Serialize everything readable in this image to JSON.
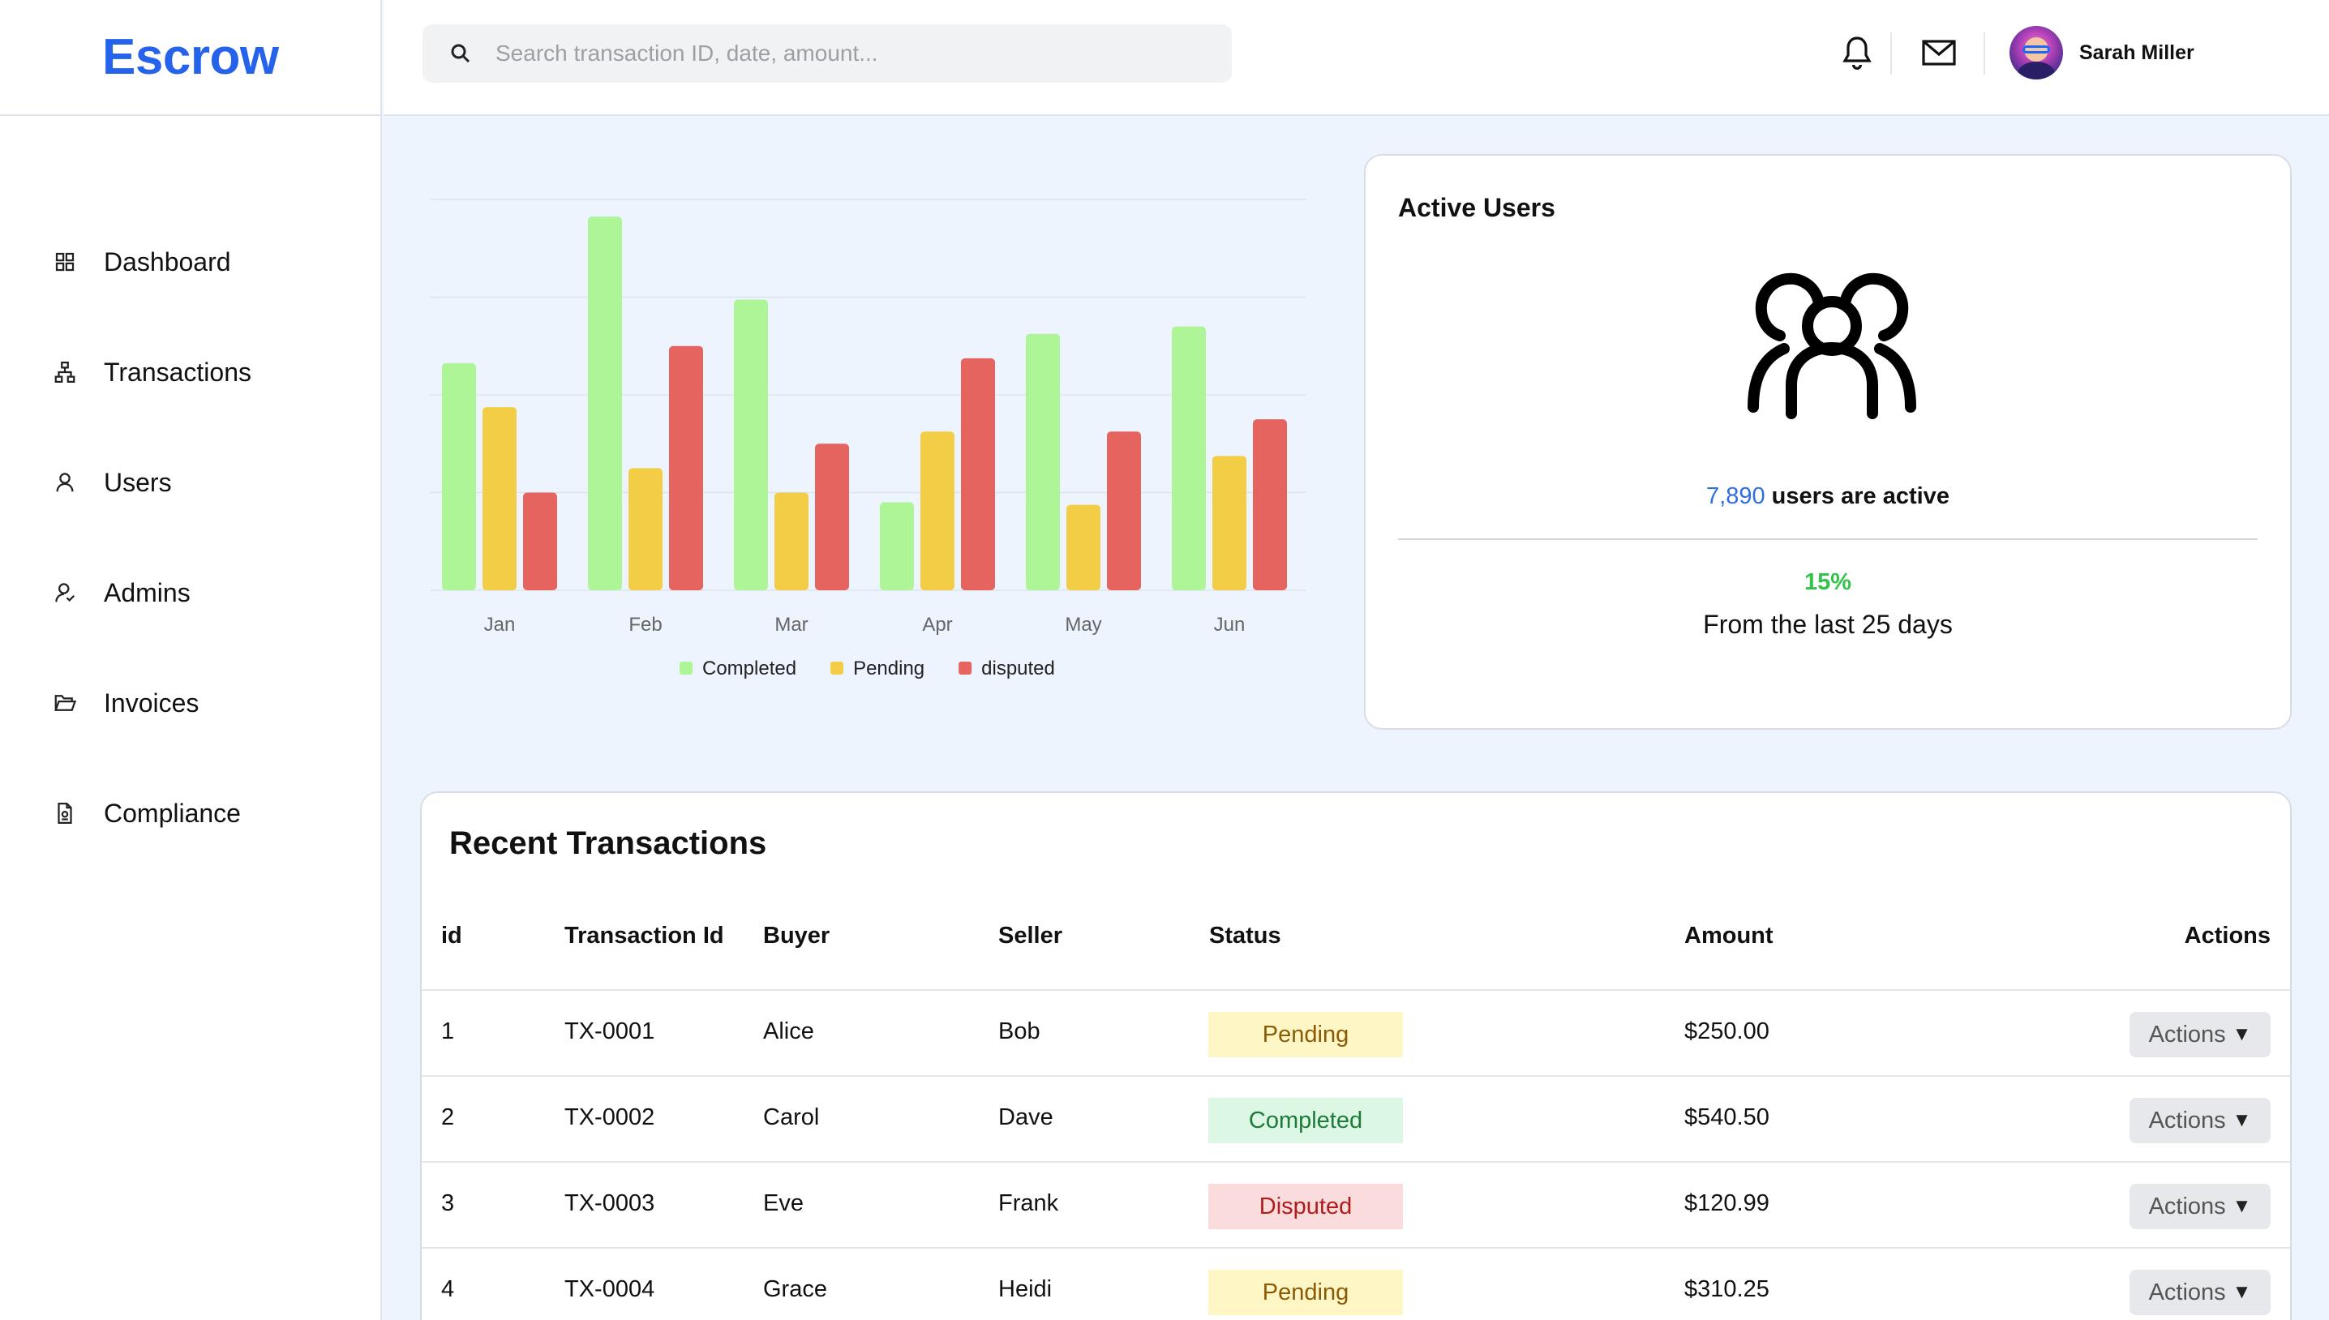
{
  "app": {
    "logo": "Escrow"
  },
  "sidebar": {
    "items": [
      {
        "label": "Dashboard",
        "icon": "grid-icon"
      },
      {
        "label": "Transactions",
        "icon": "sitemap-icon"
      },
      {
        "label": "Users",
        "icon": "user-icon"
      },
      {
        "label": "Admins",
        "icon": "admin-user-icon"
      },
      {
        "label": "Invoices",
        "icon": "folder-open-icon"
      },
      {
        "label": "Compliance",
        "icon": "document-icon"
      }
    ]
  },
  "header": {
    "search_placeholder": "Search transaction ID, date, amount...",
    "user_name": "Sarah Miller"
  },
  "colors": {
    "brand": "#2563eb",
    "completed": "#adf597",
    "pending": "#f3cd45",
    "disputed": "#e5645f"
  },
  "chart_data": {
    "type": "bar",
    "categories": [
      "Jan",
      "Feb",
      "Mar",
      "Apr",
      "May",
      "Jun"
    ],
    "series": [
      {
        "name": "Completed",
        "values": [
          93,
          153,
          119,
          36,
          105,
          108
        ]
      },
      {
        "name": "Pending",
        "values": [
          75,
          50,
          40,
          65,
          35,
          55
        ]
      },
      {
        "name": "disputed",
        "values": [
          40,
          100,
          60,
          95,
          65,
          70
        ]
      }
    ],
    "ylim": [
      0,
      160
    ],
    "grid": true,
    "legend": "bottom"
  },
  "active_users": {
    "title": "Active Users",
    "count": "7,890",
    "count_suffix": "users are active",
    "change": "15%",
    "period": "From the last 25 days"
  },
  "transactions": {
    "title": "Recent Transactions",
    "columns": [
      "id",
      "Transaction Id",
      "Buyer",
      "Seller",
      "Status",
      "Amount",
      "Actions"
    ],
    "rows": [
      {
        "id": "1",
        "tx": "TX-0001",
        "buyer": "Alice",
        "seller": "Bob",
        "status": "Pending",
        "amount": "$250.00",
        "action": "Actions"
      },
      {
        "id": "2",
        "tx": "TX-0002",
        "buyer": "Carol",
        "seller": "Dave",
        "status": "Completed",
        "amount": "$540.50",
        "action": "Actions"
      },
      {
        "id": "3",
        "tx": "TX-0003",
        "buyer": "Eve",
        "seller": "Frank",
        "status": "Disputed",
        "amount": "$120.99",
        "action": "Actions"
      },
      {
        "id": "4",
        "tx": "TX-0004",
        "buyer": "Grace",
        "seller": "Heidi",
        "status": "Pending",
        "amount": "$310.25",
        "action": "Actions"
      }
    ]
  }
}
